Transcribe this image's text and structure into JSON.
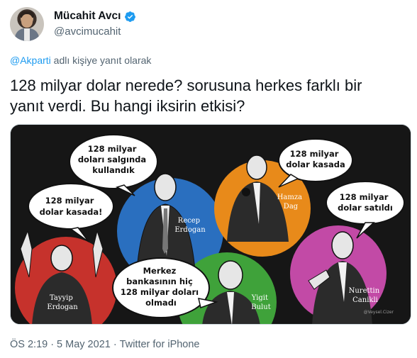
{
  "author": {
    "display_name": "Mücahit Avcı",
    "handle": "@avcimucahit",
    "verified": true
  },
  "reply": {
    "mention": "@Akparti",
    "suffix": " adlı kişiye yanıt olarak"
  },
  "tweet": {
    "text_line1": "128 milyar dolar nerede? sorusuna herkes farklı bir",
    "text_line2": "yanıt verdi. Bu hangi iksirin etkisi?"
  },
  "cartoon": {
    "bubbles": [
      {
        "lines": [
          "128 milyar",
          "doları salgında",
          "kullandık"
        ]
      },
      {
        "lines": [
          "128 milyar",
          "dolar kasada"
        ]
      },
      {
        "lines": [
          "128 milyar",
          "dolar kasada!"
        ]
      },
      {
        "lines": [
          "128 milyar",
          "dolar satıldı"
        ]
      },
      {
        "lines": [
          "Merkez",
          "bankasının hiç",
          "128 milyar doları",
          "olmadı"
        ]
      }
    ],
    "names": [
      {
        "lines": [
          "Recep",
          "Erdogan"
        ]
      },
      {
        "lines": [
          "Hamza",
          "Dag"
        ]
      },
      {
        "lines": [
          "Tayyip",
          "Erdogan"
        ]
      },
      {
        "lines": [
          "Yigit",
          "Bulut"
        ]
      },
      {
        "lines": [
          "Nurettin",
          "Canikli"
        ]
      }
    ],
    "signature": "@Veysel.Cizer",
    "colors": {
      "background": "#161616",
      "blue": "#2a6fbf",
      "orange": "#e88a1a",
      "red": "#c6322c",
      "green": "#3fa23a",
      "magenta": "#c24aa6"
    }
  },
  "meta": {
    "time": "ÖS 2:19",
    "separator1": "·",
    "date": "5 May 2021",
    "separator2": "·",
    "source": "Twitter for iPhone"
  }
}
